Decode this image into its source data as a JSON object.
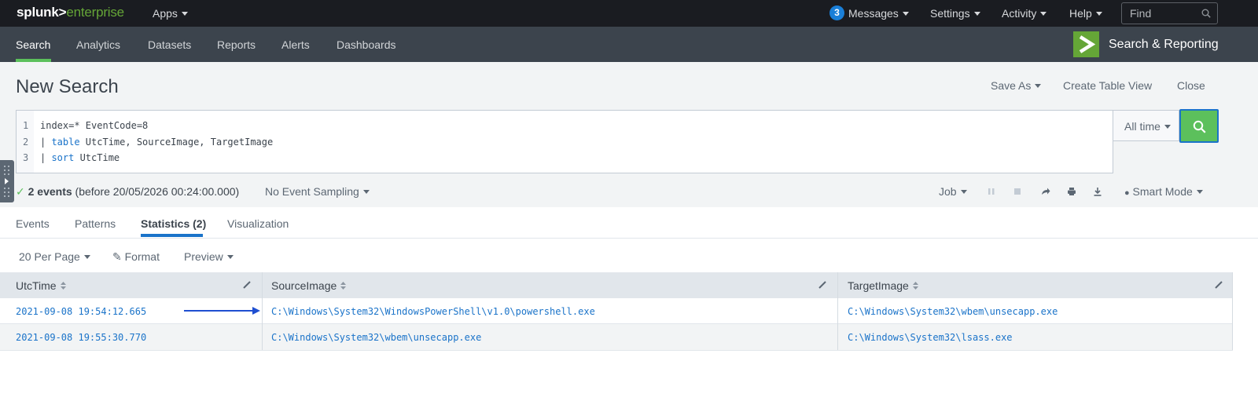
{
  "topbar": {
    "logo_part1": "splunk>",
    "logo_part2": "enterprise",
    "apps_label": "Apps",
    "messages_count": "3",
    "messages_label": "Messages",
    "settings_label": "Settings",
    "activity_label": "Activity",
    "help_label": "Help",
    "find_placeholder": "Find"
  },
  "appbar": {
    "nav": [
      "Search",
      "Analytics",
      "Datasets",
      "Reports",
      "Alerts",
      "Dashboards"
    ],
    "active_index": 0,
    "app_title": "Search & Reporting"
  },
  "search": {
    "page_title": "New Search",
    "save_as": "Save As",
    "create_table_view": "Create Table View",
    "close": "Close",
    "lines": [
      {
        "num": "1",
        "text": "index=* EventCode=8"
      },
      {
        "num": "2",
        "pipe": "| ",
        "keyword": "table",
        "rest": " UtcTime, SourceImage, TargetImage"
      },
      {
        "num": "3",
        "pipe": "| ",
        "keyword": "sort",
        "rest": " UtcTime"
      }
    ],
    "time_range": "All time",
    "status_count": "2 events",
    "status_detail": " (before 20/05/2026 00:24:00.000)",
    "sampling": "No Event Sampling",
    "job": "Job",
    "mode": "Smart Mode"
  },
  "tabs": [
    "Events",
    "Patterns",
    "Statistics (2)",
    "Visualization"
  ],
  "active_tab": 2,
  "toolbar": {
    "per_page": "20 Per Page",
    "format": "Format",
    "preview": "Preview"
  },
  "table": {
    "columns": [
      "UtcTime",
      "SourceImage",
      "TargetImage"
    ],
    "rows": [
      [
        "2021-09-08 19:54:12.665",
        "C:\\Windows\\System32\\WindowsPowerShell\\v1.0\\powershell.exe",
        "C:\\Windows\\System32\\wbem\\unsecapp.exe"
      ],
      [
        "2021-09-08 19:55:30.770",
        "C:\\Windows\\System32\\wbem\\unsecapp.exe",
        "C:\\Windows\\System32\\lsass.exe"
      ]
    ]
  },
  "colors": {
    "accent_green": "#5cc05c",
    "link_blue": "#1a73c9",
    "topbar": "#1a1c21",
    "appbar": "#3c444d"
  }
}
